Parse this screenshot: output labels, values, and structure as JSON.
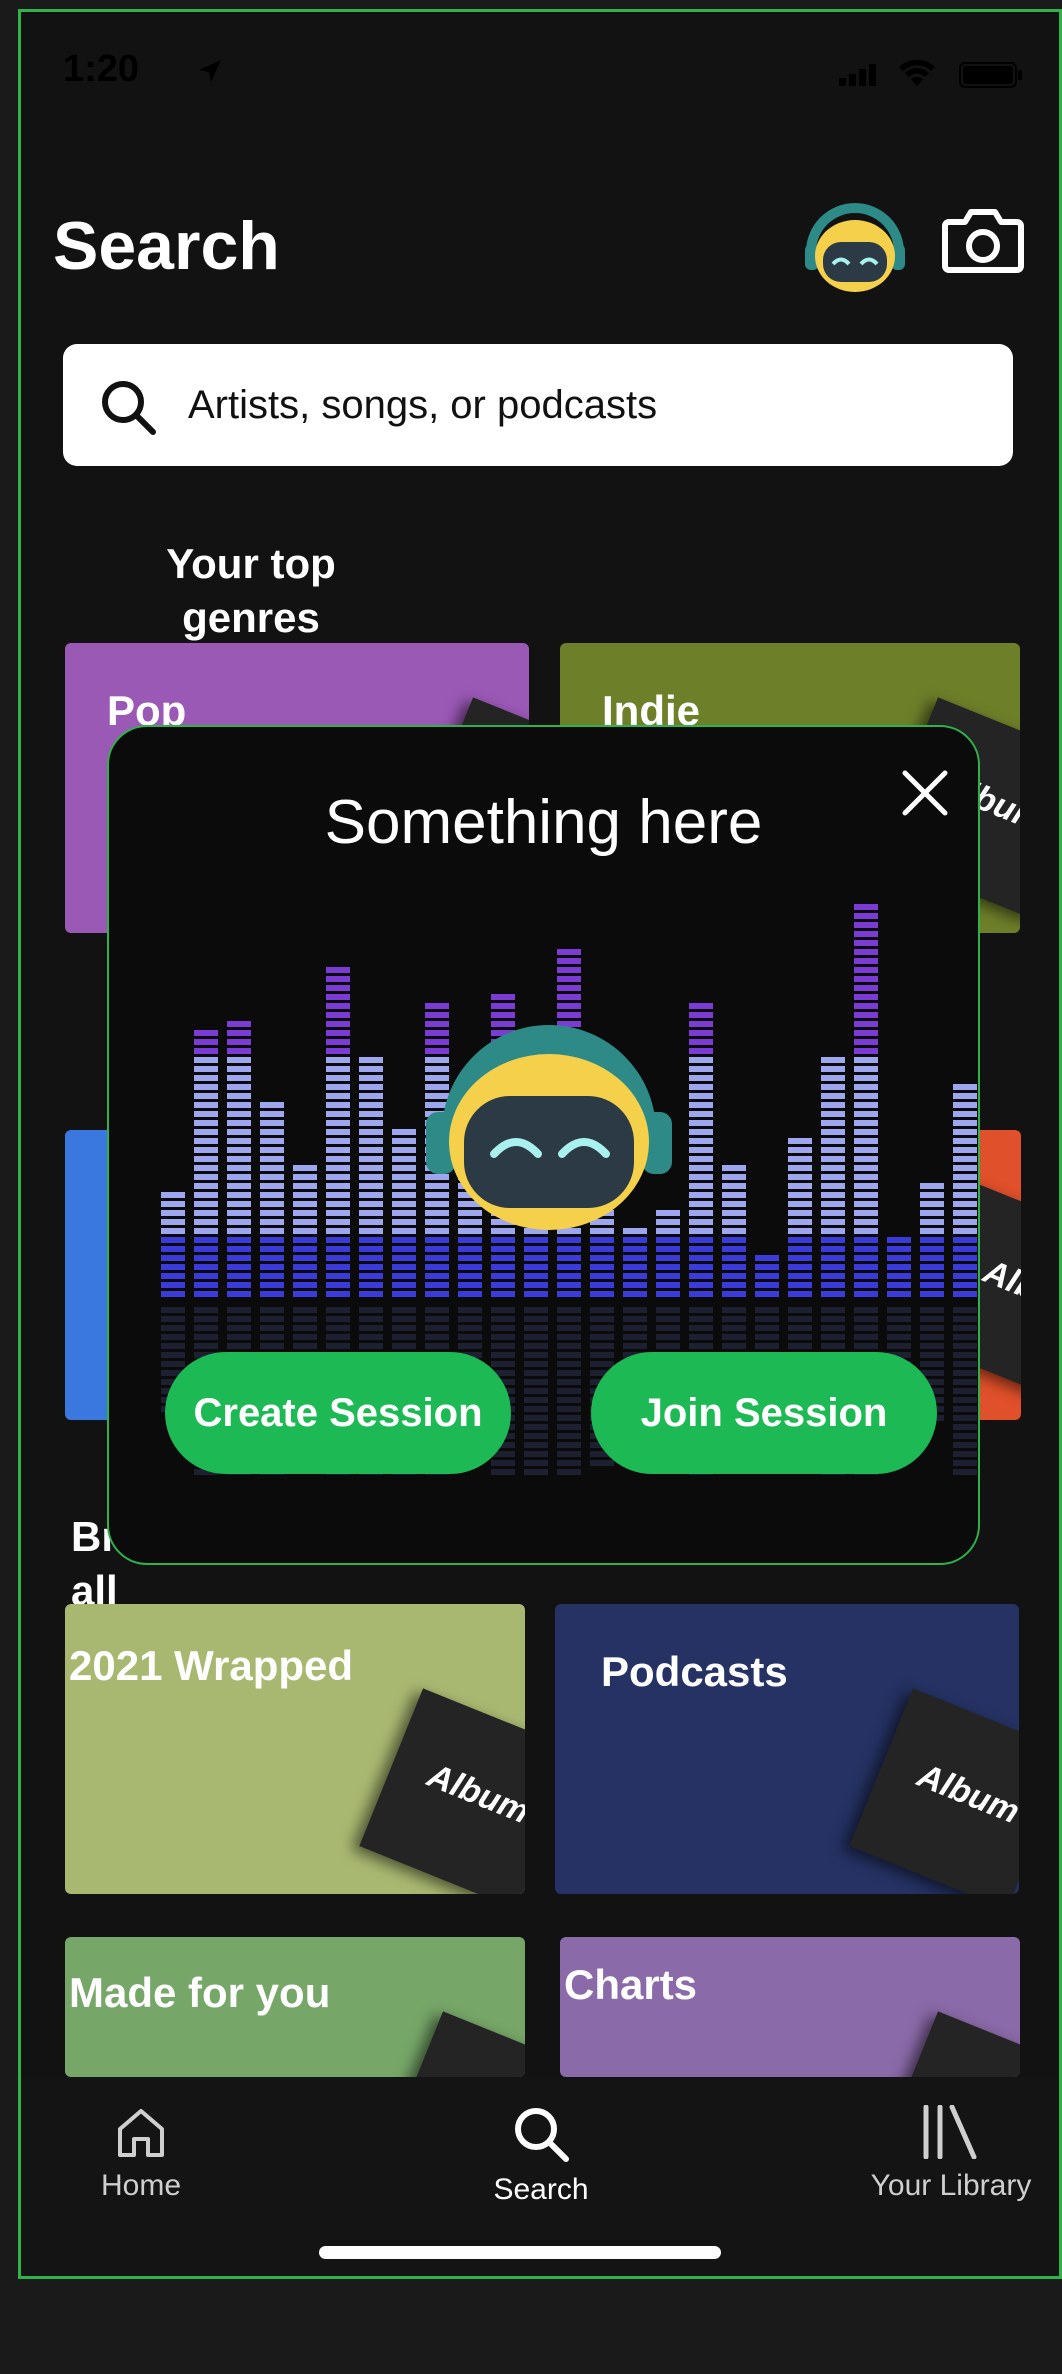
{
  "status_bar": {
    "time": "1:20"
  },
  "header": {
    "title": "Search"
  },
  "search": {
    "placeholder": "Artists, songs, or podcasts"
  },
  "sections": {
    "top_genres": "Your top genres",
    "browse_all": "Browse all"
  },
  "tiles": {
    "pop": {
      "label": "Pop",
      "color": "#9b59b6"
    },
    "indie": {
      "label": "Indie",
      "color": "#6e7f2a"
    },
    "blue": {
      "label": "",
      "color": "#3a78e0"
    },
    "orange": {
      "label": "",
      "color": "#e0502a"
    },
    "wrapped": {
      "label": "2021 Wrapped",
      "color": "#a9b871"
    },
    "podcasts": {
      "label": "Podcasts",
      "color": "#253263"
    },
    "made_for_you": {
      "label": "Made for you",
      "color": "#76a668"
    },
    "charts": {
      "label": "Charts",
      "color": "#8a6aa8"
    }
  },
  "album_label": "Album",
  "modal": {
    "title": "Something here",
    "create_label": "Create Session",
    "join_label": "Join Session"
  },
  "nav": {
    "home": "Home",
    "search": "Search",
    "library": "Your Library"
  },
  "colors": {
    "accent": "#1db954",
    "background": "#121212"
  }
}
